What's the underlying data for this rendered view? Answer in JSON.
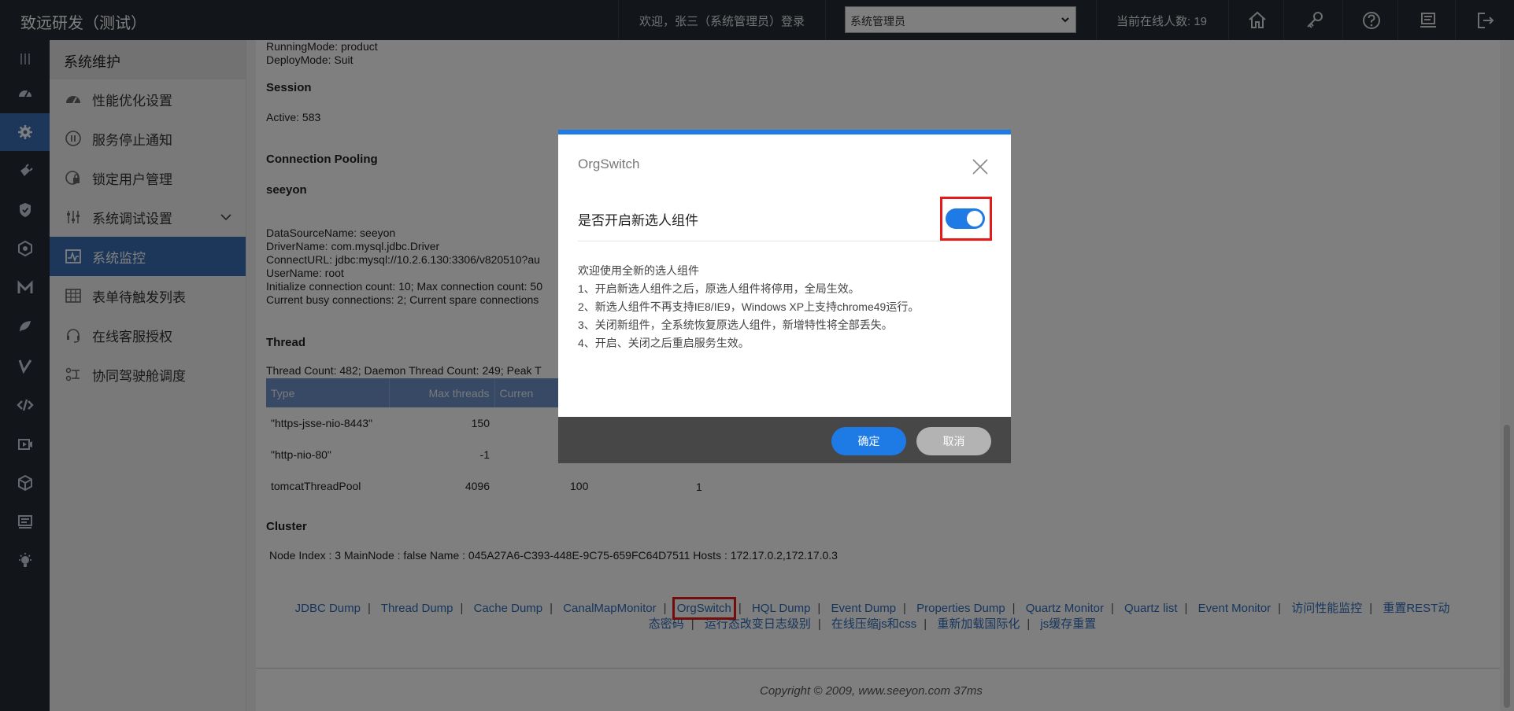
{
  "app_title": "致远研发（测试）",
  "header": {
    "welcome": "欢迎，张三（系统管理员）登录",
    "role_selected": "系统管理员",
    "online_count": "当前在线人数: 19"
  },
  "menu": {
    "title": "系统维护",
    "items": [
      {
        "label": "性能优化设置"
      },
      {
        "label": "服务停止通知"
      },
      {
        "label": "锁定用户管理"
      },
      {
        "label": "系统调试设置"
      },
      {
        "label": "系统监控"
      },
      {
        "label": "表单待触发列表"
      },
      {
        "label": "在线客服授权"
      },
      {
        "label": "协同驾驶舱调度"
      }
    ]
  },
  "content": {
    "running_mode": "RunningMode: product",
    "deploy_mode": "DeployMode: Suit",
    "session_heading": "Session",
    "session_active": "Active: 583",
    "pool_heading": "Connection Pooling",
    "pool_name": "seeyon",
    "ds_name": "DataSourceName: seeyon",
    "driver": "DriverName: com.mysql.jdbc.Driver",
    "connect_url": "ConnectURL: jdbc:mysql://10.2.6.130:3306/v820510?au",
    "username": "UserName: root",
    "init_count": "Initialize connection count: 10; Max connection count: 50",
    "busy": "Current busy connections: 2; Current spare connections",
    "thread_heading": "Thread",
    "thread_count": "Thread Count: 482; Daemon Thread Count: 249; Peak T",
    "thread_table": {
      "headers": [
        "Type",
        "Max threads",
        "Curren"
      ],
      "rows": [
        [
          "\"https-jsse-nio-8443\"",
          "150",
          "",
          ""
        ],
        [
          "\"http-nio-80\"",
          "-1",
          "",
          ""
        ],
        [
          "tomcatThreadPool",
          "4096",
          "100",
          "1"
        ]
      ]
    },
    "cluster_heading": "Cluster",
    "cluster_info": "Node Index : 3 MainNode : false Name : 045A27A6-C393-448E-9C75-659FC64D7511 Hosts : 172.17.0.2,172.17.0.3"
  },
  "links_row1": [
    "JDBC Dump",
    "Thread Dump",
    "Cache Dump",
    "CanalMapMonitor",
    "OrgSwitch",
    "HQL Dump",
    "Event Dump",
    "Properties Dump",
    "Quartz Monitor",
    "Quartz list",
    "Event Monitor",
    "访问性能监控",
    "重置REST动"
  ],
  "links_row2": [
    "态密码",
    "运行态改变日志级别",
    "在线压缩js和css",
    "重新加载国际化",
    "js缓存重置"
  ],
  "copyright": "Copyright © 2009, www.seeyon.com 37ms",
  "modal": {
    "title": "OrgSwitch",
    "option_label": "是否开启新选人组件",
    "toggle_on": true,
    "desc": [
      "欢迎使用全新的选人组件",
      "1、开启新选人组件之后，原选人组件将停用，全局生效。",
      "2、新选人组件不再支持IE8/IE9，Windows XP上支持chrome49运行。",
      "3、关闭新组件，全系统恢复原选人组件，新增特性将全部丢失。",
      "4、开启、关闭之后重启服务生效。"
    ],
    "ok_label": "确定",
    "cancel_label": "取消"
  },
  "colors": {
    "accent": "#1e7be6",
    "sidebar_dark": "#252a33",
    "menu_active": "#3b6fb5",
    "highlight": "#e31b1b"
  }
}
